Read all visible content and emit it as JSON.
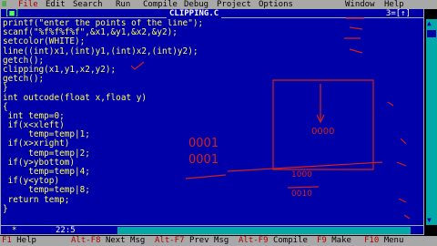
{
  "menubar": {
    "system_menu": "≡",
    "items": [
      {
        "label": "File",
        "hot": "F"
      },
      {
        "label": "Edit",
        "hot": "E"
      },
      {
        "label": "Search",
        "hot": "S"
      },
      {
        "label": "Run",
        "hot": "R"
      },
      {
        "label": "Compile",
        "hot": "C"
      },
      {
        "label": "Debug",
        "hot": "D"
      },
      {
        "label": "Project",
        "hot": "P"
      },
      {
        "label": "Options",
        "hot": "O"
      },
      {
        "label": "Window",
        "hot": "W"
      },
      {
        "label": "Help",
        "hot": "H"
      }
    ]
  },
  "editor": {
    "close_box": "[■]",
    "filename": "CLIPPING.C",
    "window_number": "3=[↑]",
    "lines": [
      {
        "text": "printf(\"enter the points of the line\");",
        "highlight": false
      },
      {
        "text": "scanf(\"%f%f%f%f\",&x1,&y1,&x2,&y2);",
        "highlight": false
      },
      {
        "text": "setcolor(WHITE);",
        "highlight": false
      },
      {
        "text": "line((int)x1,(int)y1,(int)x2,(int)y2);",
        "highlight": false
      },
      {
        "text": "getch();",
        "highlight": false
      },
      {
        "text": "clipping(x1,y1,x2,y2);",
        "highlight": false
      },
      {
        "text": "getch();",
        "highlight": false
      },
      {
        "text": "}",
        "highlight": false
      },
      {
        "text": "int outcode(float x,float y)",
        "highlight": false
      },
      {
        "text": "{",
        "highlight": false
      },
      {
        "text": " int temp=0;",
        "highlight": false
      },
      {
        "text": " if(x<xleft)",
        "highlight": false
      },
      {
        "text": "     temp=temp|1;",
        "highlight": false
      },
      {
        "text": " if(x>xright)",
        "highlight": false
      },
      {
        "text": "     temp=temp|2;",
        "highlight": false
      },
      {
        "text": " if(y>ybottom)",
        "highlight": false
      },
      {
        "text": "     temp=temp|4;",
        "highlight": false
      },
      {
        "text": " if(y<ytop)",
        "highlight": false
      },
      {
        "text": "     temp=temp|8;",
        "highlight": false
      },
      {
        "text": " return temp;",
        "highlight": false
      },
      {
        "text": "}",
        "highlight": false
      }
    ]
  },
  "statusline": {
    "modified": "*",
    "position": "22:5"
  },
  "fnbar": {
    "items": [
      {
        "key": "F1",
        "label": "Help"
      },
      {
        "key": "Alt-F8",
        "label": "Next Msg"
      },
      {
        "key": "Alt-F7",
        "label": "Prev Msg"
      },
      {
        "key": "Alt-F9",
        "label": "Compile"
      },
      {
        "key": "F9",
        "label": "Make"
      },
      {
        "key": "F10",
        "label": "Menu"
      }
    ]
  },
  "annotations": {
    "code_a": "0000",
    "code_b": "0001",
    "code_c": "0001",
    "code_d": "1000",
    "code_e": "0010"
  }
}
